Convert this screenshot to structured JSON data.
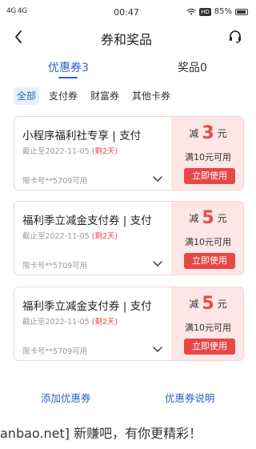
{
  "status_bar": {
    "signal": "4G 4G",
    "time": "00:47",
    "hd": "HD",
    "battery": "85%"
  },
  "nav": {
    "title": "券和奖品"
  },
  "tabs": [
    {
      "label": "优惠券3",
      "active": true
    },
    {
      "label": "奖品0",
      "active": false
    }
  ],
  "filters": [
    {
      "label": "全部",
      "active": true
    },
    {
      "label": "支付券",
      "active": false
    },
    {
      "label": "财富券",
      "active": false
    },
    {
      "label": "其他卡券",
      "active": false
    }
  ],
  "coupons": [
    {
      "name": "小程序福利社专享 | 支付",
      "expiry": "截止至2022-11-05",
      "remaining": "(剩2天)",
      "card_limit": "限卡号**5709可用",
      "prefix": "减",
      "amount": "3",
      "unit": "元",
      "condition": "满10元可用",
      "use_label": "立即使用"
    },
    {
      "name": "福利季立减金支付券 | 支付",
      "expiry": "截止至2022-11-05",
      "remaining": "(剩2天)",
      "card_limit": "限卡号**5709可用",
      "prefix": "减",
      "amount": "5",
      "unit": "元",
      "condition": "满10元可用",
      "use_label": "立即使用"
    },
    {
      "name": "福利季立减金支付券 | 支付",
      "expiry": "截止至2022-11-05",
      "remaining": "(剩2天)",
      "card_limit": "限卡号**5709可用",
      "prefix": "减",
      "amount": "5",
      "unit": "元",
      "condition": "满10元可用",
      "use_label": "立即使用"
    }
  ],
  "footer": {
    "add_label": "添加优惠券",
    "explain_label": "优惠券说明"
  },
  "watermark": "anbao.net] 新赚吧，有你更精彩！",
  "colors": {
    "accent_blue": "#2b63c8",
    "accent_red": "#e44b4b",
    "coupon_side_bg": "#fde6e6"
  }
}
